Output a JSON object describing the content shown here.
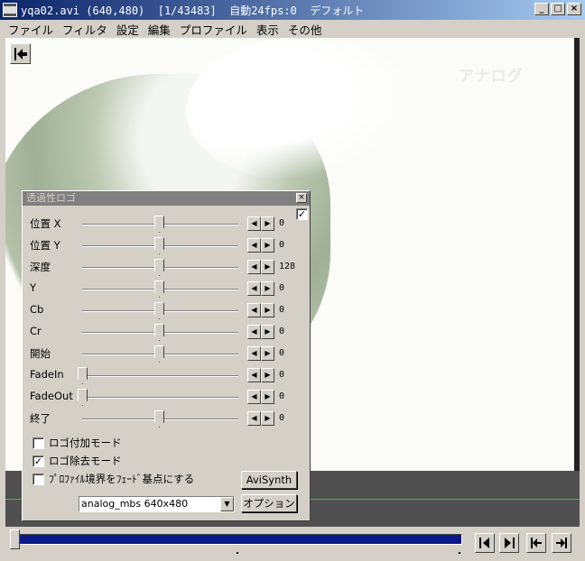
{
  "window": {
    "title": "yqa02.avi (640,480)  [1/43483]  自動24fps:0  デフォルト",
    "minimize": "_",
    "maximize": "□",
    "close": "×"
  },
  "menu": [
    "ファイル",
    "フィルタ",
    "設定",
    "編集",
    "プロファイル",
    "表示",
    "その他"
  ],
  "video": {
    "watermark": "アナログ"
  },
  "dialog": {
    "title": "透過性ロゴ",
    "enabled": true,
    "sliders": [
      {
        "label": "位置 X",
        "value": "0",
        "pos": 0.5
      },
      {
        "label": "位置 Y",
        "value": "0",
        "pos": 0.5
      },
      {
        "label": "深度",
        "value": "128",
        "pos": 0.5
      },
      {
        "label": "Y",
        "value": "0",
        "pos": 0.5
      },
      {
        "label": "Cb",
        "value": "0",
        "pos": 0.5
      },
      {
        "label": "Cr",
        "value": "0",
        "pos": 0.5
      },
      {
        "label": "開始",
        "value": "0",
        "pos": 0.5
      },
      {
        "label": "FadeIn",
        "value": "0",
        "pos": 0.0
      },
      {
        "label": "FadeOut",
        "value": "0",
        "pos": 0.0
      },
      {
        "label": "終了",
        "value": "0",
        "pos": 0.5
      }
    ],
    "checkboxes": [
      {
        "label": "ロゴ付加モード",
        "checked": false
      },
      {
        "label": "ロゴ除去モード",
        "checked": true
      },
      {
        "label": "ﾌﾟﾛﾌｧｲﾙ境界をﾌｪｰﾄﾞ基点にする",
        "checked": false
      }
    ],
    "avisynth_button": "AviSynth",
    "logo_select": "analog_mbs 640x480",
    "option_button": "オプション"
  },
  "timeline": {
    "position": 0.0
  },
  "nav_buttons": [
    "prev-frame",
    "next-frame",
    "prev-key",
    "next-key"
  ],
  "colors": {
    "title_bar": "#0a246a",
    "seek_fill": "#0a1a8a",
    "dark_panel": "#505050",
    "green_line": "#3fbf3f"
  }
}
